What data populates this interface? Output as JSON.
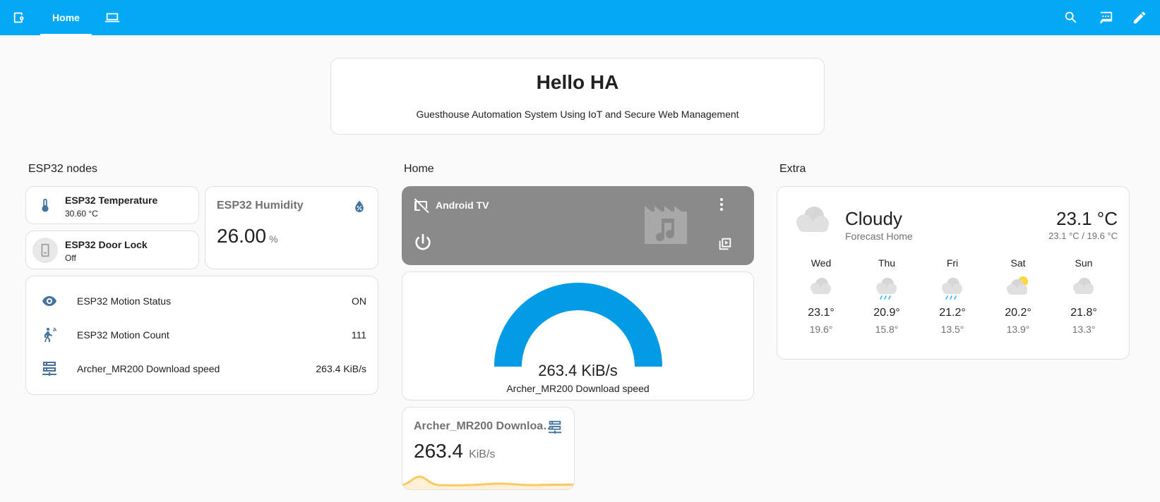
{
  "header": {
    "tab_home": "Home"
  },
  "hello": {
    "title": "Hello HA",
    "subtitle": "Guesthouse Automation System Using IoT and Secure Web Management"
  },
  "sections": {
    "esp32": "ESP32 nodes",
    "home": "Home",
    "extra": "Extra"
  },
  "temperature": {
    "name": "ESP32 Temperature",
    "state": "30.60 °C"
  },
  "door": {
    "name": "ESP32 Door Lock",
    "state": "Off"
  },
  "humidity": {
    "name": "ESP32 Humidity",
    "value": "26.00",
    "unit": "%"
  },
  "entities": [
    {
      "name": "ESP32 Motion Status",
      "value": "ON",
      "icon": "eye-icon"
    },
    {
      "name": "ESP32 Motion Count",
      "value": "111",
      "icon": "motion-sensor-icon"
    },
    {
      "name": "Archer_MR200 Download speed",
      "value": "263.4 KiB/s",
      "icon": "server-network-icon"
    }
  ],
  "media": {
    "name": "Android TV"
  },
  "gauge": {
    "value": "263.4 KiB/s",
    "name": "Archer_MR200 Download speed",
    "fraction": 1.0,
    "color": "#039be5"
  },
  "sensor_card": {
    "name": "Archer_MR200 Downloa…",
    "value": "263.4",
    "unit": "KiB/s",
    "graph_color": "#ffc864"
  },
  "weather": {
    "condition": "Cloudy",
    "location": "Forecast Home",
    "temperature": "23.1 °C",
    "range": "23.1 °C / 19.6 °C",
    "forecast": [
      {
        "day": "Wed",
        "hi": "23.1°",
        "lo": "19.6°",
        "icon": "cloudy"
      },
      {
        "day": "Thu",
        "hi": "20.9°",
        "lo": "15.8°",
        "icon": "rainy"
      },
      {
        "day": "Fri",
        "hi": "21.2°",
        "lo": "13.5°",
        "icon": "rainy"
      },
      {
        "day": "Sat",
        "hi": "20.2°",
        "lo": "13.9°",
        "icon": "partlycloudy"
      },
      {
        "day": "Sun",
        "hi": "21.8°",
        "lo": "13.3°",
        "icon": "cloudy"
      }
    ]
  }
}
